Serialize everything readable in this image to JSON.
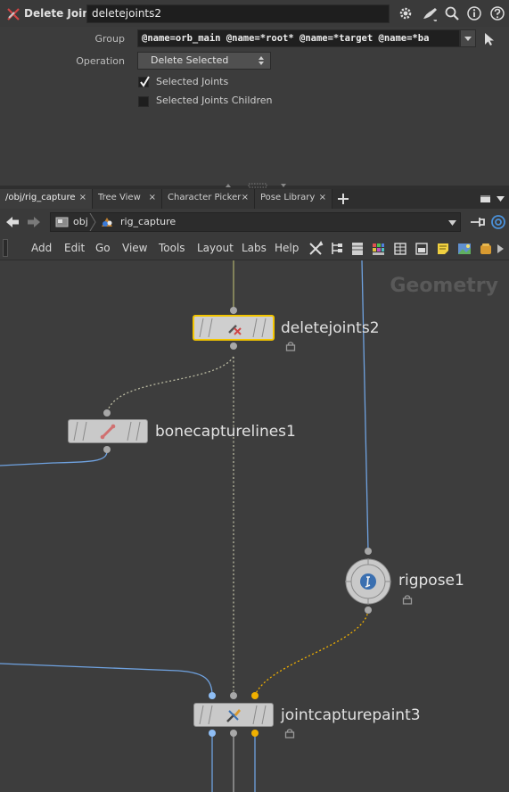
{
  "param_pane": {
    "node_type": "Delete Joints",
    "node_name": "deletejoints2",
    "group_label": "Group",
    "group_value": "@name=orb_main @name=*root* @name=*target @name=*ba",
    "operation_label": "Operation",
    "operation_value": "Delete Selected",
    "checkboxes": [
      {
        "label": "Selected Joints",
        "checked": true
      },
      {
        "label": "Selected Joints Children",
        "checked": false
      }
    ],
    "header_icons": [
      "gear-icon",
      "paintbrush-icon",
      "search-icon",
      "info-icon",
      "help-icon"
    ]
  },
  "tabs": [
    {
      "label": "/obj/rig_capture"
    },
    {
      "label": "Tree View"
    },
    {
      "label": "Character Picker"
    },
    {
      "label": "Pose Library"
    }
  ],
  "path": {
    "segments": [
      "obj",
      "rig_capture"
    ]
  },
  "menu": [
    "Add",
    "Edit",
    "Go",
    "View",
    "Tools",
    "Layout",
    "Labs",
    "Help"
  ],
  "network": {
    "context_label": "Geometry",
    "nodes": [
      {
        "name": "deletejoints2"
      },
      {
        "name": "bonecapturelines1"
      },
      {
        "name": "rigpose1"
      },
      {
        "name": "jointcapturepaint3"
      }
    ]
  },
  "colors": {
    "selection": "#f3c500",
    "wire_blue": "#6fa2e0",
    "wire_orange": "#f0b000",
    "wire_olive": "#a8a86a"
  }
}
